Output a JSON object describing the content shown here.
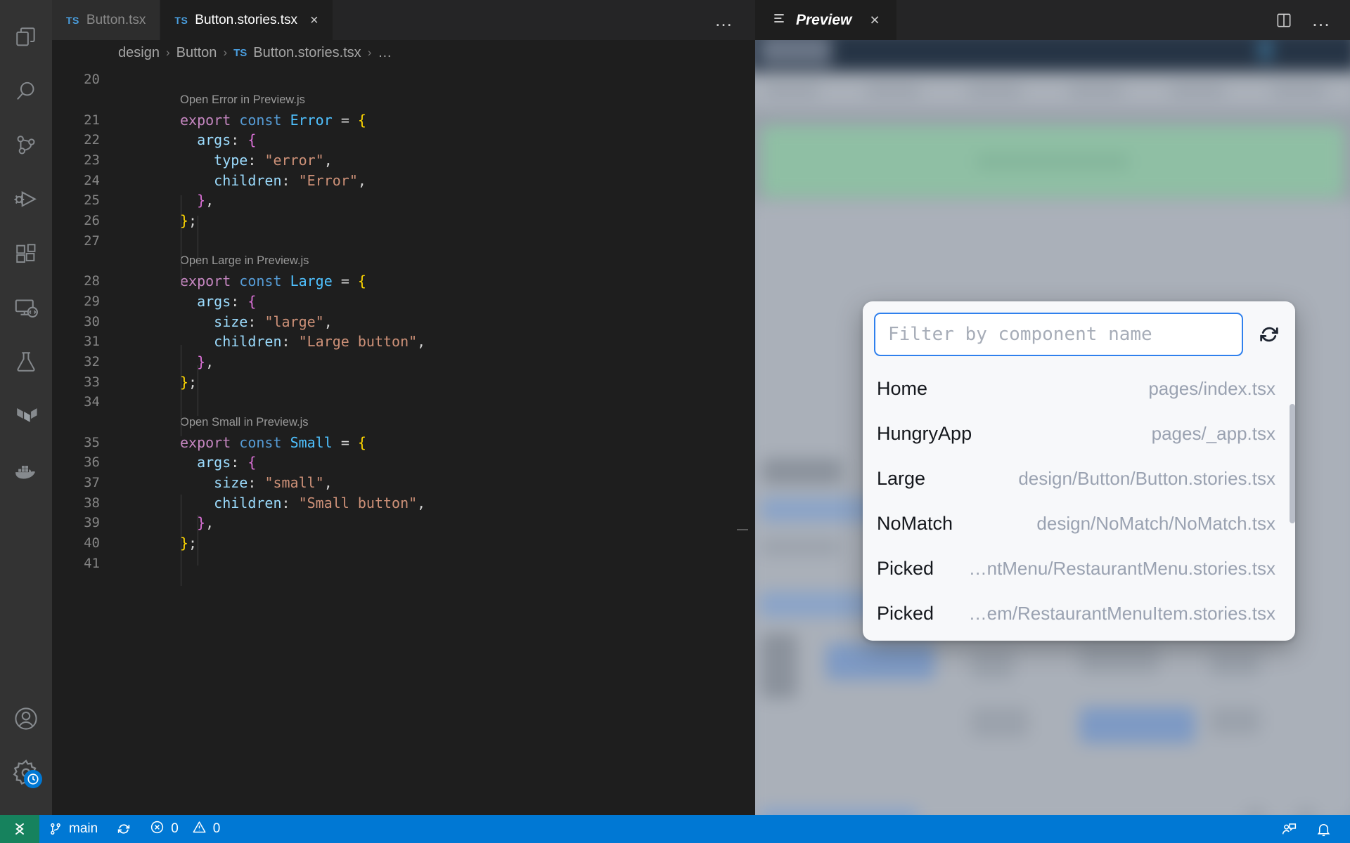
{
  "window": {
    "activity_bar": [
      {
        "name": "explorer-icon",
        "label": "Explorer"
      },
      {
        "name": "search-icon",
        "label": "Search"
      },
      {
        "name": "source-control-icon",
        "label": "Source Control"
      },
      {
        "name": "run-and-debug-icon",
        "label": "Run and Debug"
      },
      {
        "name": "extensions-icon",
        "label": "Extensions"
      },
      {
        "name": "remote-explorer-icon",
        "label": "Remote Explorer"
      },
      {
        "name": "testing-icon",
        "label": "Testing"
      },
      {
        "name": "terraform-icon",
        "label": "Terraform"
      },
      {
        "name": "docker-icon",
        "label": "Docker"
      }
    ],
    "activity_bar_bottom": [
      {
        "name": "accounts-icon",
        "label": "Accounts"
      },
      {
        "name": "settings-gear-icon",
        "label": "Manage"
      }
    ]
  },
  "editor": {
    "tabs": [
      {
        "ts": "TS",
        "label": "Button.tsx",
        "active": false,
        "closable": false
      },
      {
        "ts": "TS",
        "label": "Button.stories.tsx",
        "active": true,
        "closable": true,
        "close": "×"
      }
    ],
    "tabs_more": "…",
    "breadcrumb": {
      "part1": "design",
      "sep1": "›",
      "part2": "Button",
      "sep2": "›",
      "ts": "TS",
      "part3": "Button.stories.tsx",
      "sep3": "›",
      "part4": "…"
    },
    "codelens": {
      "error": "Open Error in Preview.js",
      "large": "Open Large in Preview.js",
      "small": "Open Small in Preview.js"
    },
    "lines": [
      {
        "n": "20",
        "tokens": []
      },
      {
        "n": "21",
        "tokens": [
          {
            "t": "export",
            "c": "t-kw"
          },
          {
            "t": " ",
            "c": "t-plain"
          },
          {
            "t": "const",
            "c": "t-const"
          },
          {
            "t": " ",
            "c": "t-plain"
          },
          {
            "t": "Error",
            "c": "t-var"
          },
          {
            "t": " ",
            "c": "t-plain"
          },
          {
            "t": "=",
            "c": "t-op"
          },
          {
            "t": " ",
            "c": "t-plain"
          },
          {
            "t": "{",
            "c": "t-brace1"
          }
        ]
      },
      {
        "n": "22",
        "tokens": [
          {
            "t": "  ",
            "c": "t-plain"
          },
          {
            "t": "args",
            "c": "t-prop"
          },
          {
            "t": ": ",
            "c": "t-plain"
          },
          {
            "t": "{",
            "c": "t-brace2"
          }
        ]
      },
      {
        "n": "23",
        "tokens": [
          {
            "t": "    ",
            "c": "t-plain"
          },
          {
            "t": "type",
            "c": "t-prop"
          },
          {
            "t": ": ",
            "c": "t-plain"
          },
          {
            "t": "\"error\"",
            "c": "t-str"
          },
          {
            "t": ",",
            "c": "t-plain"
          }
        ]
      },
      {
        "n": "24",
        "tokens": [
          {
            "t": "    ",
            "c": "t-plain"
          },
          {
            "t": "children",
            "c": "t-prop"
          },
          {
            "t": ": ",
            "c": "t-plain"
          },
          {
            "t": "\"Error\"",
            "c": "t-str"
          },
          {
            "t": ",",
            "c": "t-plain"
          }
        ]
      },
      {
        "n": "25",
        "tokens": [
          {
            "t": "  ",
            "c": "t-plain"
          },
          {
            "t": "}",
            "c": "t-brace2"
          },
          {
            "t": ",",
            "c": "t-plain"
          }
        ]
      },
      {
        "n": "26",
        "tokens": [
          {
            "t": "}",
            "c": "t-brace1"
          },
          {
            "t": ";",
            "c": "t-plain"
          }
        ]
      },
      {
        "n": "27",
        "tokens": []
      },
      {
        "n": "28",
        "tokens": [
          {
            "t": "export",
            "c": "t-kw"
          },
          {
            "t": " ",
            "c": "t-plain"
          },
          {
            "t": "const",
            "c": "t-const"
          },
          {
            "t": " ",
            "c": "t-plain"
          },
          {
            "t": "Large",
            "c": "t-var"
          },
          {
            "t": " ",
            "c": "t-plain"
          },
          {
            "t": "=",
            "c": "t-op"
          },
          {
            "t": " ",
            "c": "t-plain"
          },
          {
            "t": "{",
            "c": "t-brace1"
          }
        ]
      },
      {
        "n": "29",
        "tokens": [
          {
            "t": "  ",
            "c": "t-plain"
          },
          {
            "t": "args",
            "c": "t-prop"
          },
          {
            "t": ": ",
            "c": "t-plain"
          },
          {
            "t": "{",
            "c": "t-brace2"
          }
        ]
      },
      {
        "n": "30",
        "tokens": [
          {
            "t": "    ",
            "c": "t-plain"
          },
          {
            "t": "size",
            "c": "t-prop"
          },
          {
            "t": ": ",
            "c": "t-plain"
          },
          {
            "t": "\"large\"",
            "c": "t-str"
          },
          {
            "t": ",",
            "c": "t-plain"
          }
        ]
      },
      {
        "n": "31",
        "tokens": [
          {
            "t": "    ",
            "c": "t-plain"
          },
          {
            "t": "children",
            "c": "t-prop"
          },
          {
            "t": ": ",
            "c": "t-plain"
          },
          {
            "t": "\"Large button\"",
            "c": "t-str"
          },
          {
            "t": ",",
            "c": "t-plain"
          }
        ]
      },
      {
        "n": "32",
        "tokens": [
          {
            "t": "  ",
            "c": "t-plain"
          },
          {
            "t": "}",
            "c": "t-brace2"
          },
          {
            "t": ",",
            "c": "t-plain"
          }
        ]
      },
      {
        "n": "33",
        "tokens": [
          {
            "t": "}",
            "c": "t-brace1"
          },
          {
            "t": ";",
            "c": "t-plain"
          }
        ]
      },
      {
        "n": "34",
        "tokens": []
      },
      {
        "n": "35",
        "tokens": [
          {
            "t": "export",
            "c": "t-kw"
          },
          {
            "t": " ",
            "c": "t-plain"
          },
          {
            "t": "const",
            "c": "t-const"
          },
          {
            "t": " ",
            "c": "t-plain"
          },
          {
            "t": "Small",
            "c": "t-var"
          },
          {
            "t": " ",
            "c": "t-plain"
          },
          {
            "t": "=",
            "c": "t-op"
          },
          {
            "t": " ",
            "c": "t-plain"
          },
          {
            "t": "{",
            "c": "t-brace1"
          }
        ]
      },
      {
        "n": "36",
        "tokens": [
          {
            "t": "  ",
            "c": "t-plain"
          },
          {
            "t": "args",
            "c": "t-prop"
          },
          {
            "t": ": ",
            "c": "t-plain"
          },
          {
            "t": "{",
            "c": "t-brace2"
          }
        ]
      },
      {
        "n": "37",
        "tokens": [
          {
            "t": "    ",
            "c": "t-plain"
          },
          {
            "t": "size",
            "c": "t-prop"
          },
          {
            "t": ": ",
            "c": "t-plain"
          },
          {
            "t": "\"small\"",
            "c": "t-str"
          },
          {
            "t": ",",
            "c": "t-plain"
          }
        ]
      },
      {
        "n": "38",
        "tokens": [
          {
            "t": "    ",
            "c": "t-plain"
          },
          {
            "t": "children",
            "c": "t-prop"
          },
          {
            "t": ": ",
            "c": "t-plain"
          },
          {
            "t": "\"Small button\"",
            "c": "t-str"
          },
          {
            "t": ",",
            "c": "t-plain"
          }
        ]
      },
      {
        "n": "39",
        "tokens": [
          {
            "t": "  ",
            "c": "t-plain"
          },
          {
            "t": "}",
            "c": "t-brace2"
          },
          {
            "t": ",",
            "c": "t-plain"
          }
        ]
      },
      {
        "n": "40",
        "tokens": [
          {
            "t": "}",
            "c": "t-brace1"
          },
          {
            "t": ";",
            "c": "t-plain"
          }
        ]
      },
      {
        "n": "41",
        "tokens": []
      }
    ]
  },
  "preview": {
    "tab_label": "Preview",
    "tab_close": "×",
    "actions": [
      {
        "name": "split-editor-icon"
      },
      {
        "name": "more-actions-icon",
        "label": "…"
      }
    ]
  },
  "modal": {
    "filter_placeholder": "Filter by component name",
    "filter_value": "",
    "refresh_icon": "refresh-icon",
    "items": [
      {
        "name": "Home",
        "path": "pages/index.tsx"
      },
      {
        "name": "HungryApp",
        "path": "pages/_app.tsx"
      },
      {
        "name": "Large",
        "path": "design/Button/Button.stories.tsx"
      },
      {
        "name": "NoMatch",
        "path": "design/NoMatch/NoMatch.tsx"
      },
      {
        "name": "Picked",
        "path": "…ntMenu/RestaurantMenu.stories.tsx"
      },
      {
        "name": "Picked",
        "path": "…em/RestaurantMenuItem.stories.tsx"
      }
    ]
  },
  "status_bar": {
    "remote_icon": "remote-window-icon",
    "branch": "main",
    "sync_icon": "sync-icon",
    "errors": "0",
    "warnings": "0",
    "feedback_icon": "feedback-icon",
    "bell_icon": "notifications-bell-icon"
  },
  "colors": {
    "status_bar": "#0078d4",
    "remote_green": "#16825d",
    "accent_blue": "#2f80ed",
    "editor_bg": "#1e1e1e",
    "tab_bar_bg": "#252526",
    "activity_bar_bg": "#333333"
  }
}
